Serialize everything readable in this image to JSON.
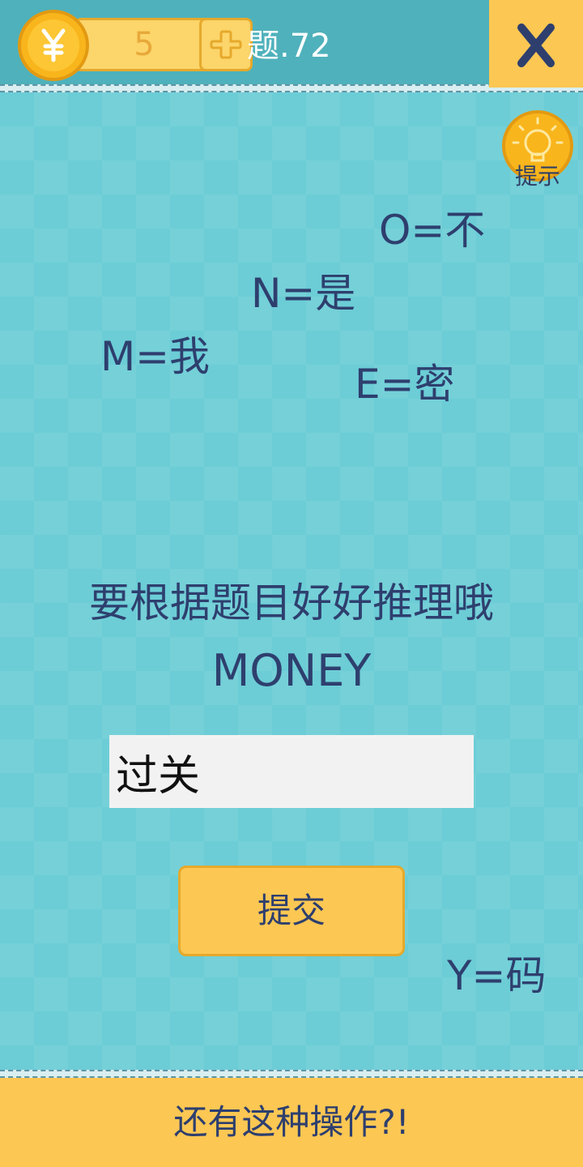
{
  "header": {
    "coins": "5",
    "level": "题.72",
    "close_label": "X"
  },
  "hint": {
    "label": "提示"
  },
  "clues": {
    "o": "O=不",
    "n": "N=是",
    "m": "M=我",
    "e": "E=密",
    "y": "Y=码"
  },
  "puzzle": {
    "prompt": "要根据题目好好推理哦",
    "word": "MONEY"
  },
  "answer": {
    "value": "过关"
  },
  "submit": {
    "label": "提交"
  },
  "footer": {
    "label": "还有这种操作?!"
  },
  "colors": {
    "topbar": "#4fb1bb",
    "background": "#6ccdd6",
    "accent": "#fcc753",
    "text": "#2e3f6e"
  }
}
